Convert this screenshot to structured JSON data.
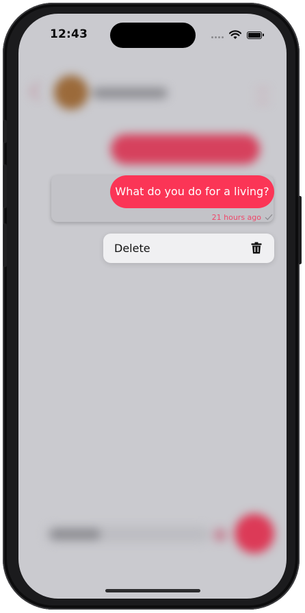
{
  "status_bar": {
    "time": "12:43"
  },
  "message": {
    "text": "What do you do for a living?",
    "timestamp": "21 hours ago",
    "status_icon": "checkmark-icon"
  },
  "context_menu": {
    "items": [
      {
        "label": "Delete",
        "icon": "trash-icon"
      }
    ]
  },
  "colors": {
    "accent": "#fb3556",
    "timestamp": "#f0476a",
    "menu_background": "#f0f0f2"
  }
}
